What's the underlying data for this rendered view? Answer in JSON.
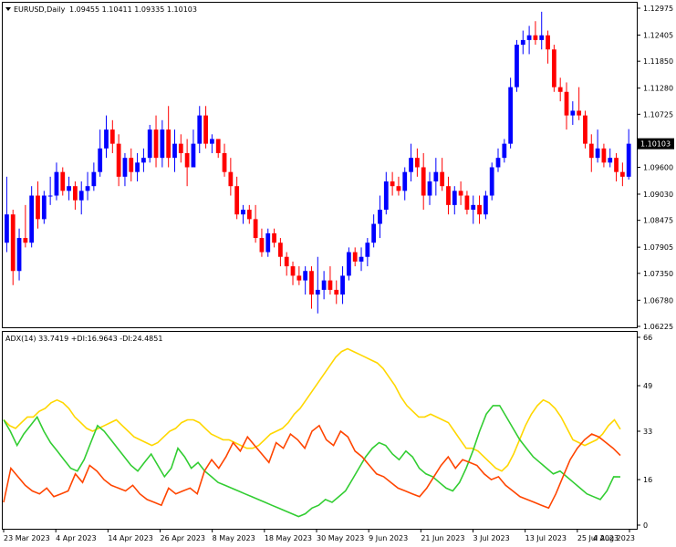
{
  "header": {
    "symbol": "EURUSD,Daily",
    "ohlc": "1.09455 1.10411 1.09335 1.10103"
  },
  "indicator": {
    "label": "ADX(14) 33.7419 +DI:16.9643 -DI:24.4851"
  },
  "current_price_label": "1.10103",
  "colors": {
    "bull": "#0000ff",
    "bear": "#ff0000",
    "adx": "#ffd700",
    "plus_di": "#32cd32",
    "minus_di": "#ff4500",
    "grid": "#000000",
    "background": "#ffffff"
  },
  "chart_data": [
    {
      "type": "candlestick",
      "title": "EURUSD,Daily",
      "ylim": [
        1.06225,
        1.12975
      ],
      "y_ticks": [
        "1.12975",
        "1.12405",
        "1.11850",
        "1.11280",
        "1.10725",
        "1.10155",
        "1.09600",
        "1.09030",
        "1.08475",
        "1.07905",
        "1.07350",
        "1.06780",
        "1.06225"
      ],
      "grid": false,
      "candles": [
        {
          "o": 1.08,
          "h": 1.094,
          "l": 1.078,
          "c": 1.086
        },
        {
          "o": 1.086,
          "h": 1.087,
          "l": 1.071,
          "c": 1.074
        },
        {
          "o": 1.074,
          "h": 1.083,
          "l": 1.072,
          "c": 1.081
        },
        {
          "o": 1.081,
          "h": 1.088,
          "l": 1.079,
          "c": 1.08
        },
        {
          "o": 1.08,
          "h": 1.092,
          "l": 1.079,
          "c": 1.09
        },
        {
          "o": 1.09,
          "h": 1.093,
          "l": 1.083,
          "c": 1.085
        },
        {
          "o": 1.085,
          "h": 1.091,
          "l": 1.084,
          "c": 1.09
        },
        {
          "o": 1.09,
          "h": 1.094,
          "l": 1.088,
          "c": 1.09
        },
        {
          "o": 1.09,
          "h": 1.097,
          "l": 1.089,
          "c": 1.095
        },
        {
          "o": 1.095,
          "h": 1.096,
          "l": 1.09,
          "c": 1.091
        },
        {
          "o": 1.091,
          "h": 1.094,
          "l": 1.089,
          "c": 1.092
        },
        {
          "o": 1.092,
          "h": 1.093,
          "l": 1.087,
          "c": 1.089
        },
        {
          "o": 1.089,
          "h": 1.093,
          "l": 1.086,
          "c": 1.091
        },
        {
          "o": 1.091,
          "h": 1.095,
          "l": 1.089,
          "c": 1.092
        },
        {
          "o": 1.092,
          "h": 1.097,
          "l": 1.091,
          "c": 1.095
        },
        {
          "o": 1.095,
          "h": 1.104,
          "l": 1.094,
          "c": 1.1
        },
        {
          "o": 1.1,
          "h": 1.107,
          "l": 1.098,
          "c": 1.104
        },
        {
          "o": 1.104,
          "h": 1.106,
          "l": 1.099,
          "c": 1.101
        },
        {
          "o": 1.101,
          "h": 1.103,
          "l": 1.092,
          "c": 1.094
        },
        {
          "o": 1.094,
          "h": 1.099,
          "l": 1.092,
          "c": 1.098
        },
        {
          "o": 1.098,
          "h": 1.1,
          "l": 1.093,
          "c": 1.095
        },
        {
          "o": 1.095,
          "h": 1.099,
          "l": 1.093,
          "c": 1.097
        },
        {
          "o": 1.097,
          "h": 1.1,
          "l": 1.095,
          "c": 1.098
        },
        {
          "o": 1.098,
          "h": 1.105,
          "l": 1.097,
          "c": 1.104
        },
        {
          "o": 1.104,
          "h": 1.107,
          "l": 1.096,
          "c": 1.098
        },
        {
          "o": 1.098,
          "h": 1.106,
          "l": 1.096,
          "c": 1.104
        },
        {
          "o": 1.104,
          "h": 1.109,
          "l": 1.096,
          "c": 1.098
        },
        {
          "o": 1.098,
          "h": 1.104,
          "l": 1.095,
          "c": 1.101
        },
        {
          "o": 1.101,
          "h": 1.103,
          "l": 1.097,
          "c": 1.099
        },
        {
          "o": 1.099,
          "h": 1.102,
          "l": 1.092,
          "c": 1.096
        },
        {
          "o": 1.096,
          "h": 1.104,
          "l": 1.096,
          "c": 1.101
        },
        {
          "o": 1.101,
          "h": 1.109,
          "l": 1.099,
          "c": 1.107
        },
        {
          "o": 1.107,
          "h": 1.109,
          "l": 1.1,
          "c": 1.101
        },
        {
          "o": 1.101,
          "h": 1.103,
          "l": 1.099,
          "c": 1.102
        },
        {
          "o": 1.102,
          "h": 1.102,
          "l": 1.098,
          "c": 1.099
        },
        {
          "o": 1.099,
          "h": 1.101,
          "l": 1.094,
          "c": 1.095
        },
        {
          "o": 1.095,
          "h": 1.098,
          "l": 1.09,
          "c": 1.092
        },
        {
          "o": 1.092,
          "h": 1.094,
          "l": 1.085,
          "c": 1.086
        },
        {
          "o": 1.086,
          "h": 1.088,
          "l": 1.084,
          "c": 1.087
        },
        {
          "o": 1.087,
          "h": 1.088,
          "l": 1.084,
          "c": 1.085
        },
        {
          "o": 1.085,
          "h": 1.088,
          "l": 1.08,
          "c": 1.081
        },
        {
          "o": 1.081,
          "h": 1.083,
          "l": 1.077,
          "c": 1.078
        },
        {
          "o": 1.078,
          "h": 1.083,
          "l": 1.077,
          "c": 1.082
        },
        {
          "o": 1.082,
          "h": 1.083,
          "l": 1.079,
          "c": 1.08
        },
        {
          "o": 1.08,
          "h": 1.081,
          "l": 1.075,
          "c": 1.077
        },
        {
          "o": 1.077,
          "h": 1.078,
          "l": 1.073,
          "c": 1.075
        },
        {
          "o": 1.075,
          "h": 1.076,
          "l": 1.071,
          "c": 1.073
        },
        {
          "o": 1.073,
          "h": 1.075,
          "l": 1.071,
          "c": 1.072
        },
        {
          "o": 1.072,
          "h": 1.075,
          "l": 1.069,
          "c": 1.074
        },
        {
          "o": 1.074,
          "h": 1.075,
          "l": 1.066,
          "c": 1.069
        },
        {
          "o": 1.069,
          "h": 1.077,
          "l": 1.065,
          "c": 1.07
        },
        {
          "o": 1.07,
          "h": 1.074,
          "l": 1.068,
          "c": 1.072
        },
        {
          "o": 1.072,
          "h": 1.075,
          "l": 1.069,
          "c": 1.07
        },
        {
          "o": 1.07,
          "h": 1.072,
          "l": 1.067,
          "c": 1.069
        },
        {
          "o": 1.069,
          "h": 1.075,
          "l": 1.067,
          "c": 1.073
        },
        {
          "o": 1.073,
          "h": 1.079,
          "l": 1.072,
          "c": 1.078
        },
        {
          "o": 1.078,
          "h": 1.079,
          "l": 1.075,
          "c": 1.076
        },
        {
          "o": 1.076,
          "h": 1.079,
          "l": 1.074,
          "c": 1.077
        },
        {
          "o": 1.077,
          "h": 1.081,
          "l": 1.075,
          "c": 1.08
        },
        {
          "o": 1.08,
          "h": 1.086,
          "l": 1.079,
          "c": 1.084
        },
        {
          "o": 1.084,
          "h": 1.09,
          "l": 1.081,
          "c": 1.087
        },
        {
          "o": 1.087,
          "h": 1.095,
          "l": 1.086,
          "c": 1.093
        },
        {
          "o": 1.093,
          "h": 1.095,
          "l": 1.09,
          "c": 1.092
        },
        {
          "o": 1.092,
          "h": 1.094,
          "l": 1.09,
          "c": 1.091
        },
        {
          "o": 1.091,
          "h": 1.096,
          "l": 1.089,
          "c": 1.095
        },
        {
          "o": 1.095,
          "h": 1.101,
          "l": 1.093,
          "c": 1.098
        },
        {
          "o": 1.098,
          "h": 1.1,
          "l": 1.094,
          "c": 1.096
        },
        {
          "o": 1.096,
          "h": 1.099,
          "l": 1.087,
          "c": 1.09
        },
        {
          "o": 1.09,
          "h": 1.095,
          "l": 1.088,
          "c": 1.093
        },
        {
          "o": 1.093,
          "h": 1.098,
          "l": 1.09,
          "c": 1.095
        },
        {
          "o": 1.095,
          "h": 1.098,
          "l": 1.091,
          "c": 1.092
        },
        {
          "o": 1.092,
          "h": 1.094,
          "l": 1.086,
          "c": 1.088
        },
        {
          "o": 1.088,
          "h": 1.092,
          "l": 1.086,
          "c": 1.091
        },
        {
          "o": 1.091,
          "h": 1.093,
          "l": 1.088,
          "c": 1.09
        },
        {
          "o": 1.09,
          "h": 1.091,
          "l": 1.086,
          "c": 1.087
        },
        {
          "o": 1.087,
          "h": 1.09,
          "l": 1.084,
          "c": 1.088
        },
        {
          "o": 1.088,
          "h": 1.09,
          "l": 1.084,
          "c": 1.086
        },
        {
          "o": 1.086,
          "h": 1.091,
          "l": 1.085,
          "c": 1.09
        },
        {
          "o": 1.09,
          "h": 1.097,
          "l": 1.089,
          "c": 1.096
        },
        {
          "o": 1.096,
          "h": 1.1,
          "l": 1.095,
          "c": 1.098
        },
        {
          "o": 1.098,
          "h": 1.102,
          "l": 1.097,
          "c": 1.101
        },
        {
          "o": 1.101,
          "h": 1.115,
          "l": 1.1,
          "c": 1.113
        },
        {
          "o": 1.113,
          "h": 1.123,
          "l": 1.112,
          "c": 1.122
        },
        {
          "o": 1.122,
          "h": 1.125,
          "l": 1.12,
          "c": 1.123
        },
        {
          "o": 1.123,
          "h": 1.126,
          "l": 1.12,
          "c": 1.124
        },
        {
          "o": 1.124,
          "h": 1.127,
          "l": 1.122,
          "c": 1.123
        },
        {
          "o": 1.123,
          "h": 1.129,
          "l": 1.121,
          "c": 1.124
        },
        {
          "o": 1.124,
          "h": 1.125,
          "l": 1.118,
          "c": 1.121
        },
        {
          "o": 1.121,
          "h": 1.122,
          "l": 1.112,
          "c": 1.113
        },
        {
          "o": 1.113,
          "h": 1.115,
          "l": 1.11,
          "c": 1.112
        },
        {
          "o": 1.112,
          "h": 1.114,
          "l": 1.104,
          "c": 1.107
        },
        {
          "o": 1.107,
          "h": 1.11,
          "l": 1.105,
          "c": 1.108
        },
        {
          "o": 1.108,
          "h": 1.113,
          "l": 1.106,
          "c": 1.107
        },
        {
          "o": 1.107,
          "h": 1.108,
          "l": 1.1,
          "c": 1.101
        },
        {
          "o": 1.101,
          "h": 1.103,
          "l": 1.095,
          "c": 1.098
        },
        {
          "o": 1.098,
          "h": 1.104,
          "l": 1.097,
          "c": 1.1
        },
        {
          "o": 1.1,
          "h": 1.101,
          "l": 1.096,
          "c": 1.097
        },
        {
          "o": 1.097,
          "h": 1.1,
          "l": 1.096,
          "c": 1.098
        },
        {
          "o": 1.098,
          "h": 1.099,
          "l": 1.093,
          "c": 1.095
        },
        {
          "o": 1.095,
          "h": 1.097,
          "l": 1.092,
          "c": 1.094
        },
        {
          "o": 1.094,
          "h": 1.1041,
          "l": 1.0934,
          "c": 1.101
        }
      ]
    },
    {
      "type": "line",
      "title": "ADX(14) 33.7419 +DI:16.9643 -DI:24.4851",
      "ylim": [
        0,
        66
      ],
      "y_ticks": [
        "66",
        "49",
        "33",
        "16",
        "0"
      ],
      "x_ticks": [
        "23 Mar 2023",
        "4 Apr 2023",
        "14 Apr 2023",
        "26 Apr 2023",
        "8 May 2023",
        "18 May 2023",
        "30 May 2023",
        "9 Jun 2023",
        "21 Jun 2023",
        "3 Jul 2023",
        "13 Jul 2023",
        "25 Jul 2023",
        "4 Aug 2023"
      ],
      "series": [
        {
          "name": "ADX",
          "color": "#ffd700",
          "values": [
            37,
            35,
            34,
            36,
            38,
            38,
            40,
            41,
            43,
            44,
            43,
            41,
            38,
            36,
            34,
            33,
            34,
            35,
            36,
            37,
            35,
            33,
            31,
            30,
            29,
            28,
            29,
            31,
            33,
            34,
            36,
            37,
            37,
            36,
            34,
            32,
            31,
            30,
            30,
            29,
            28,
            27,
            27,
            28,
            30,
            32,
            33,
            34,
            36,
            39,
            41,
            44,
            47,
            50,
            53,
            56,
            59,
            61,
            62,
            61,
            60,
            59,
            58,
            57,
            55,
            52,
            49,
            45,
            42,
            40,
            38,
            38,
            39,
            38,
            37,
            36,
            33,
            30,
            27,
            27,
            26,
            24,
            22,
            20,
            19,
            21,
            25,
            30,
            35,
            39,
            42,
            44,
            43,
            41,
            38,
            34,
            30,
            29,
            28,
            29,
            30,
            32,
            35,
            37,
            33.7
          ]
        },
        {
          "name": "+DI",
          "color": "#32cd32",
          "values": [
            37,
            33,
            28,
            32,
            35,
            38,
            33,
            29,
            26,
            23,
            20,
            19,
            23,
            29,
            35,
            33,
            30,
            27,
            24,
            21,
            19,
            22,
            25,
            21,
            17,
            20,
            27,
            24,
            20,
            22,
            19,
            17,
            15,
            14,
            13,
            12,
            11,
            10,
            9,
            8,
            7,
            6,
            5,
            4,
            3,
            4,
            6,
            7,
            9,
            8,
            10,
            12,
            16,
            20,
            24,
            27,
            29,
            28,
            25,
            23,
            26,
            24,
            20,
            18,
            17,
            15,
            13,
            12,
            15,
            20,
            26,
            33,
            39,
            42,
            42,
            38,
            34,
            30,
            27,
            24,
            22,
            20,
            18,
            19,
            17,
            15,
            13,
            11,
            10,
            9,
            12,
            17,
            16.96
          ]
        },
        {
          "name": "-DI",
          "color": "#ff4500",
          "values": [
            8,
            20,
            17,
            14,
            12,
            11,
            13,
            10,
            11,
            12,
            18,
            15,
            21,
            19,
            16,
            14,
            13,
            12,
            14,
            11,
            9,
            8,
            7,
            13,
            11,
            12,
            13,
            11,
            19,
            23,
            20,
            24,
            29,
            26,
            31,
            28,
            25,
            22,
            29,
            27,
            32,
            30,
            27,
            33,
            35,
            30,
            28,
            33,
            31,
            26,
            24,
            21,
            18,
            17,
            15,
            13,
            12,
            11,
            10,
            13,
            17,
            21,
            24,
            20,
            23,
            22,
            21,
            18,
            16,
            17,
            14,
            12,
            10,
            9,
            8,
            7,
            6,
            11,
            17,
            23,
            27,
            30,
            32,
            31,
            29,
            27,
            24.49
          ]
        }
      ]
    }
  ]
}
